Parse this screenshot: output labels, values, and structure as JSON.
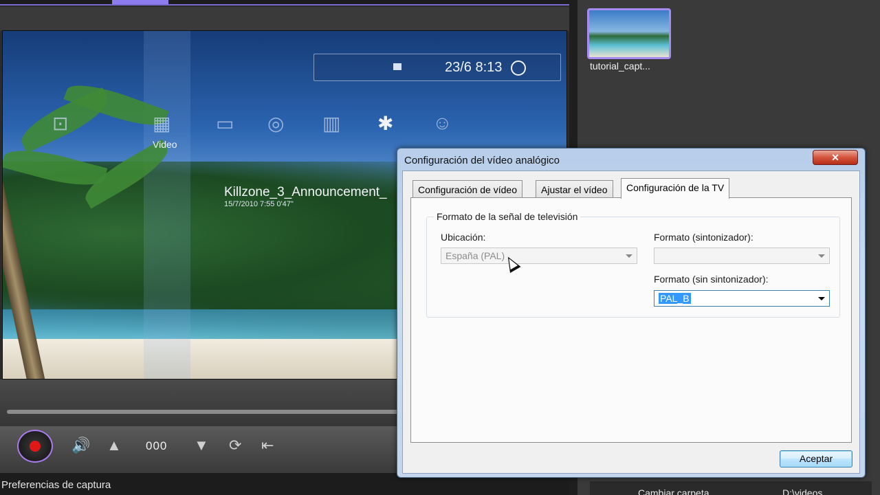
{
  "preview": {
    "clock": "23/6 8:13",
    "section_label": "Video",
    "media_title": "Killzone_3_Announcement_",
    "media_meta": "15/7/2010  7:55   0'47\""
  },
  "controls": {
    "counter": "000"
  },
  "status": {
    "text": "Preferencias de captura"
  },
  "library": {
    "thumb_label": "tutorial_capt...",
    "change_folder": "Cambiar carpeta",
    "path": "D:\\videos"
  },
  "dialog": {
    "title": "Configuración del vídeo analógico",
    "close_glyph": "✕",
    "tabs": [
      {
        "label": "Configuración de vídeo"
      },
      {
        "label": "Ajustar el vídeo"
      },
      {
        "label": "Configuración de la TV"
      }
    ],
    "group_title": "Formato de la señal de televisión",
    "location_label": "Ubicación:",
    "location_value": "España (PAL)",
    "tuner_format_label": "Formato (sintonizador):",
    "tuner_format_value": "",
    "no_tuner_format_label": "Formato (sin sintonizador):",
    "no_tuner_format_value": "PAL_B",
    "separator": "---",
    "accept_label": "Aceptar"
  },
  "icons": {
    "volume": "🔊",
    "up": "▲",
    "down": "▼",
    "refresh": "⟳",
    "input": "⇤"
  }
}
